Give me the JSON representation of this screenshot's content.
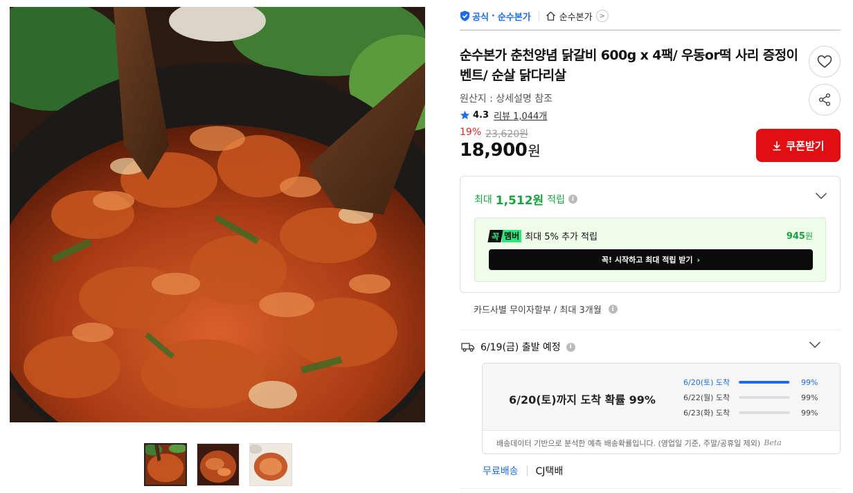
{
  "store": {
    "official_label": "공식",
    "official_store": "순수본가",
    "store_name": "순수본가"
  },
  "product": {
    "title": "순수본가 춘천양념 닭갈비 600g x 4팩/ 우동or떡 사리 증정이벤트/ 순살 닭다리살",
    "origin": "원산지 : 상세설명 참조",
    "rating": "4.3",
    "review_label": "리뷰",
    "review_count": "1,044개",
    "discount": "19%",
    "original_price": "23,620원",
    "price": "18,900",
    "currency": "원",
    "coupon_label": "쿠폰받기"
  },
  "points": {
    "prefix": "최대",
    "amount": "1,512원",
    "suffix": "적립",
    "member_badge_1": "꼭",
    "member_badge_2": "멤버",
    "member_text": "최대 5% 추가 적립",
    "member_amount": "945",
    "member_currency": "원",
    "start_button": "꼭! 시작하고 최대 적립 받기"
  },
  "installment": "카드사별 무이자할부 / 최대 3개월",
  "shipping": {
    "departure": "6/19(금) 출발 예정",
    "headline": "6/20(토)까지 도착 확률 99%",
    "rows": [
      {
        "date": "6/20(토) 도착",
        "prob": "99%",
        "value": 0.99
      },
      {
        "date": "6/22(월) 도착",
        "prob": "99%",
        "value": 0
      },
      {
        "date": "6/23(화) 도착",
        "prob": "99%",
        "value": 0
      }
    ],
    "footnote": "배송데이터 기반으로 분석한 예측 배송확률입니다. (영업일 기준, 주말/공휴일 제외)",
    "beta": "Beta",
    "free_label": "무료배송",
    "carrier": "CJ택배"
  },
  "colors": {
    "accent_blue": "#1e6ce8",
    "coupon_red": "#e00f13",
    "discount_red": "#e5262b",
    "points_green": "#19a23e"
  }
}
